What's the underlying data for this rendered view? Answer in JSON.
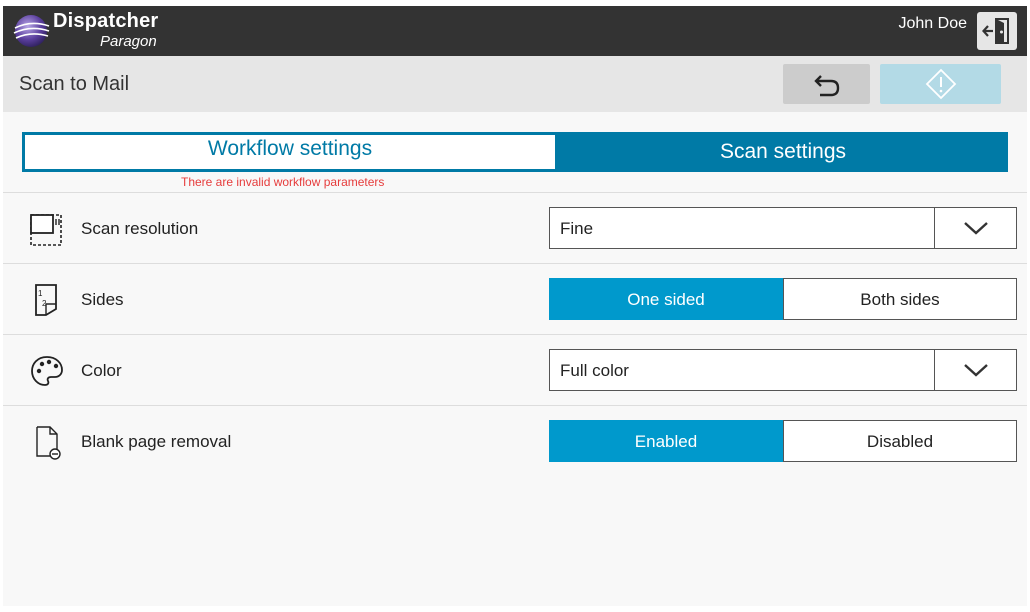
{
  "header": {
    "brand_name": "Dispatcher",
    "brand_sub": "Paragon",
    "user_name": "John Doe"
  },
  "titlebar": {
    "title": "Scan to Mail"
  },
  "tabs": {
    "workflow_label": "Workflow settings",
    "scan_label": "Scan settings",
    "error_message": "There are invalid workflow parameters"
  },
  "settings": {
    "resolution": {
      "label": "Scan resolution",
      "value": "Fine"
    },
    "sides": {
      "label": "Sides",
      "options": [
        "One sided",
        "Both sides"
      ],
      "selected": "One sided"
    },
    "color": {
      "label": "Color",
      "value": "Full color"
    },
    "blank_page": {
      "label": "Blank page removal",
      "options": [
        "Enabled",
        "Disabled"
      ],
      "selected": "Enabled"
    }
  },
  "colors": {
    "accent": "#007aa6",
    "toggle_on": "#0099cc",
    "error": "#e63c3c",
    "topbar": "#333333",
    "start_disabled": "#b3dae6"
  },
  "icons": {
    "logo": "dispatcher-logo",
    "logout": "logout-icon",
    "back": "undo-arrow-icon",
    "start": "start-diamond-icon",
    "resolution": "scan-resolution-icon",
    "sides": "page-sides-icon",
    "color": "palette-icon",
    "blank_page": "blank-page-icon",
    "dropdown": "chevron-down-icon"
  }
}
